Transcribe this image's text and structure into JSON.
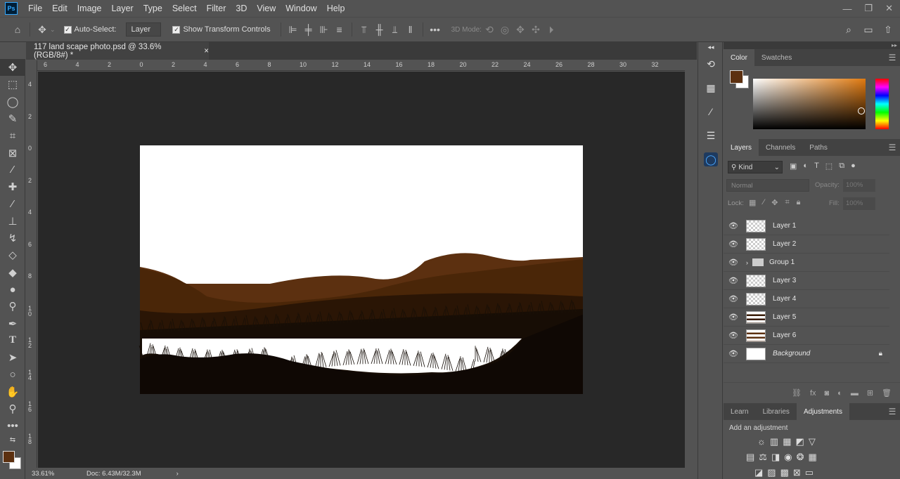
{
  "menu": {
    "items": [
      "File",
      "Edit",
      "Image",
      "Layer",
      "Type",
      "Select",
      "Filter",
      "3D",
      "View",
      "Window",
      "Help"
    ],
    "logo": "Ps"
  },
  "options": {
    "auto_select_label": "Auto-Select:",
    "auto_select_value": "Layer",
    "show_transform_label": "Show Transform Controls",
    "mode_3d_label": "3D Mode:",
    "more_label": "•••"
  },
  "document": {
    "tab_title": "117 land scape photo.psd @ 33.6% (RGB/8#) *",
    "close": "×",
    "zoom": "33.61%",
    "doc_size": "Doc: 6.43M/32.3M"
  },
  "ruler_top": [
    "6",
    "4",
    "2",
    "0",
    "2",
    "4",
    "6",
    "8",
    "10",
    "12",
    "14",
    "16",
    "18",
    "20",
    "22",
    "24",
    "26",
    "28",
    "30",
    "32"
  ],
  "ruler_left": [
    "4",
    "2",
    "0",
    "2",
    "4",
    "6",
    "8",
    "1\n0",
    "1\n2",
    "1\n4",
    "1\n6",
    "1\n8"
  ],
  "color_panel": {
    "tabs": [
      "Color",
      "Swatches"
    ],
    "foreground": "#5c3010",
    "background": "#ffffff",
    "accent": "#e07a10"
  },
  "layers_panel": {
    "tabs": [
      "Layers",
      "Channels",
      "Paths"
    ],
    "kind_label": "Kind",
    "blend_mode": "Normal",
    "opacity_label": "Opacity:",
    "opacity_value": "100%",
    "lock_label": "Lock:",
    "fill_label": "Fill:",
    "fill_value": "100%",
    "layers": [
      {
        "name": "Layer 1"
      },
      {
        "name": "Layer 2"
      },
      {
        "name": "Group 1"
      },
      {
        "name": "Layer 3"
      },
      {
        "name": "Layer 4"
      },
      {
        "name": "Layer 5"
      },
      {
        "name": "Layer 6"
      },
      {
        "name": "Background"
      }
    ]
  },
  "adjustments_panel": {
    "tabs": [
      "Learn",
      "Libraries",
      "Adjustments"
    ],
    "hint": "Add an adjustment"
  },
  "colors": {
    "hill_brown": "#5c3010",
    "hill_mid": "#4a2608",
    "hill_dark": "#2a1505",
    "ground": "#120a04",
    "canvas_bg": "#282828"
  }
}
